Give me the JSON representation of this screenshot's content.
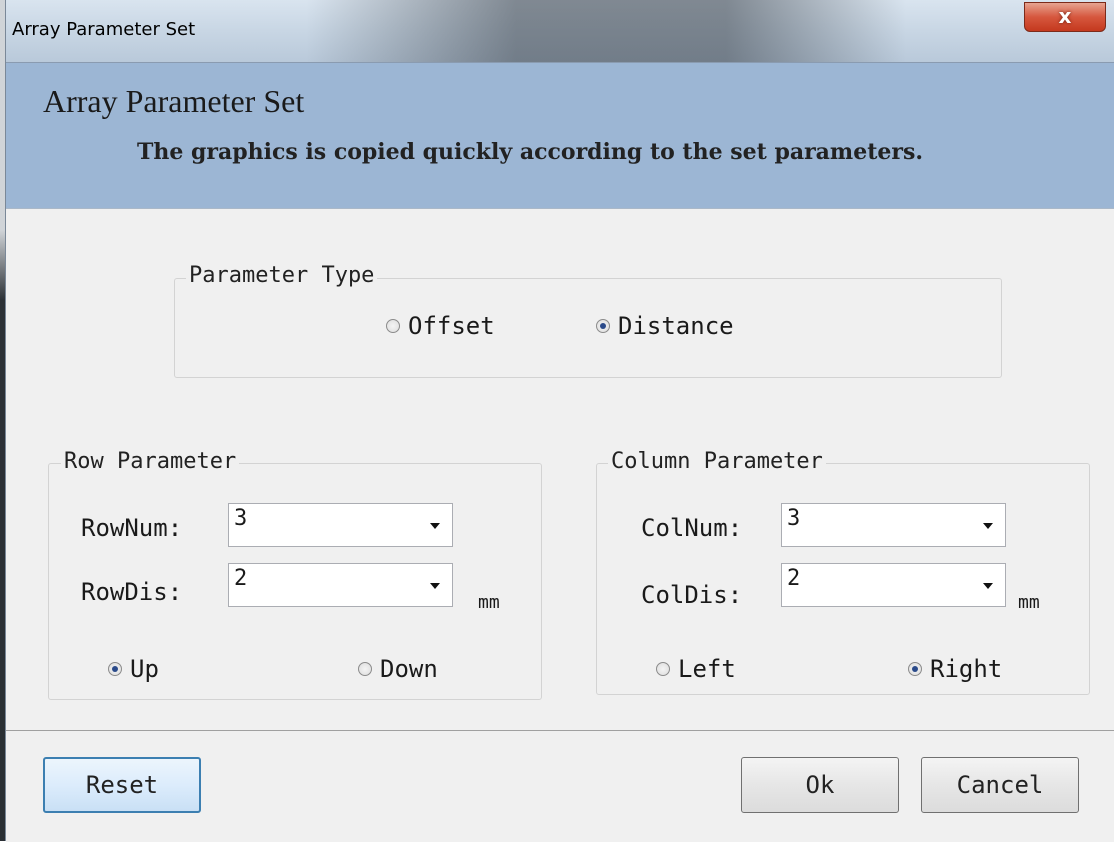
{
  "window": {
    "title": "Array Parameter Set",
    "close_symbol": "x"
  },
  "header": {
    "title": "Array Parameter Set",
    "subtitle": "The graphics is copied quickly according to the set parameters."
  },
  "parameter_type": {
    "label": "Parameter Type",
    "options": [
      {
        "label": "Offset",
        "selected": false
      },
      {
        "label": "Distance",
        "selected": true
      }
    ]
  },
  "row_parameter": {
    "label": "Row Parameter",
    "num_label": "RowNum:",
    "num_value": "3",
    "dis_label": "RowDis:",
    "dis_value": "2",
    "unit": "mm",
    "directions": [
      {
        "label": "Up",
        "selected": true
      },
      {
        "label": "Down",
        "selected": false
      }
    ]
  },
  "column_parameter": {
    "label": "Column Parameter",
    "num_label": "ColNum:",
    "num_value": "3",
    "dis_label": "ColDis:",
    "dis_value": "2",
    "unit": "mm",
    "directions": [
      {
        "label": "Left",
        "selected": false
      },
      {
        "label": "Right",
        "selected": true
      }
    ]
  },
  "buttons": {
    "reset": "Reset",
    "ok": "Ok",
    "cancel": "Cancel"
  }
}
